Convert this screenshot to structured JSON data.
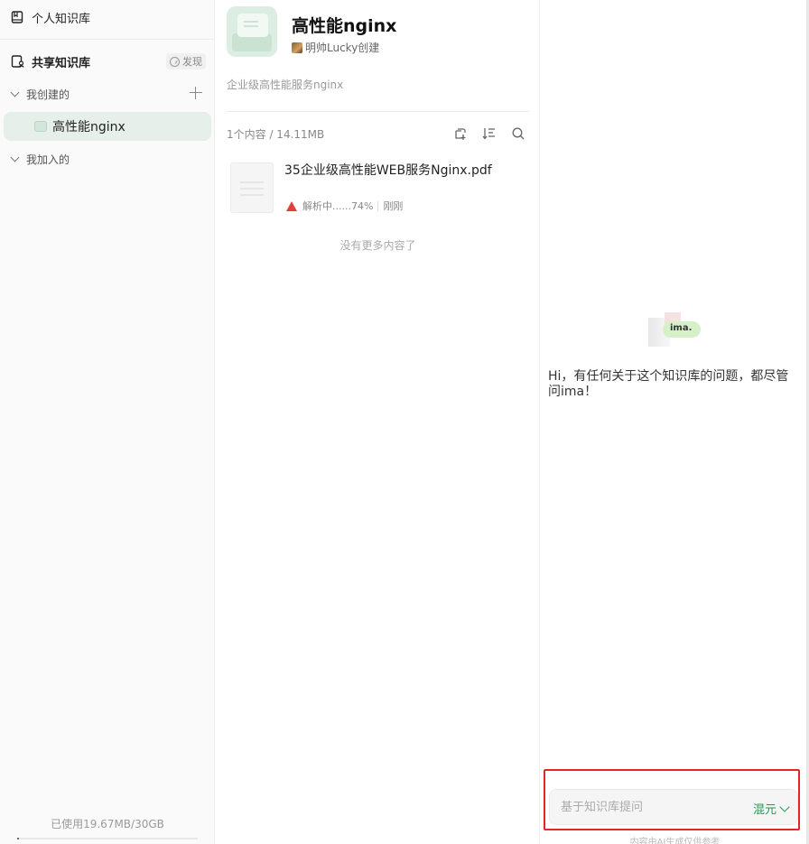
{
  "sidebar": {
    "personal_label": "个人知识库",
    "shared_label": "共享知识库",
    "discover_label": "发现",
    "created_label": "我创建的",
    "active_item_label": "高性能nginx",
    "joined_label": "我加入的",
    "usage_text": "已使用19.67MB/30GB",
    "usage_fraction": 0.0007
  },
  "kb": {
    "title": "高性能nginx",
    "creator": "明帅Lucky创建",
    "description": "企业级高性能服务nginx",
    "stats": "1个内容 / 14.11MB"
  },
  "files": [
    {
      "name": "35企业级高性能WEB服务Nginx.pdf",
      "status": "解析中......74%",
      "time": "刚刚"
    }
  ],
  "list_end_text": "没有更多内容了",
  "chat": {
    "logo_text": "ima.",
    "greeting": "Hi，有任何关于这个知识库的问题，都尽管问ima！",
    "input_placeholder": "基于知识库提问",
    "model_label": "混元",
    "disclaimer": "内容由AI生成仅供参考"
  },
  "colors": {
    "accent": "#1e9b52",
    "active_bg": "#e7efea",
    "highlight": "#e32626",
    "pdf": "#e0403a"
  },
  "icons": {
    "personal": "book-icon",
    "shared": "shared-book-icon",
    "discover": "compass-icon",
    "add": "plus-icon",
    "upload": "add-content-icon",
    "sort": "sort-icon",
    "search": "search-icon",
    "pdf": "pdf-icon",
    "model": "chevron-down-icon"
  }
}
